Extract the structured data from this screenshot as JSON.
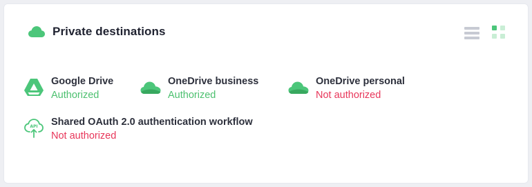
{
  "header": {
    "title": "Private destinations",
    "cloud_icon": "cloud-icon",
    "accent_color": "#4cc67a"
  },
  "view_toggle": {
    "list_icon": "list-view-icon",
    "grid_icon": "grid-view-icon",
    "active": "grid"
  },
  "destinations": [
    {
      "name": "Google Drive",
      "status": "Authorized",
      "authorized": true,
      "icon": "google-drive-icon"
    },
    {
      "name": "OneDrive business",
      "status": "Authorized",
      "authorized": true,
      "icon": "onedrive-icon"
    },
    {
      "name": "OneDrive personal",
      "status": "Not authorized",
      "authorized": false,
      "icon": "onedrive-icon"
    },
    {
      "name": "Shared OAuth 2.0 authentication workflow",
      "status": "Not authorized",
      "authorized": false,
      "icon": "api-cloud-icon"
    }
  ],
  "colors": {
    "authorized": "#4cc06f",
    "not_authorized": "#e8365a"
  }
}
